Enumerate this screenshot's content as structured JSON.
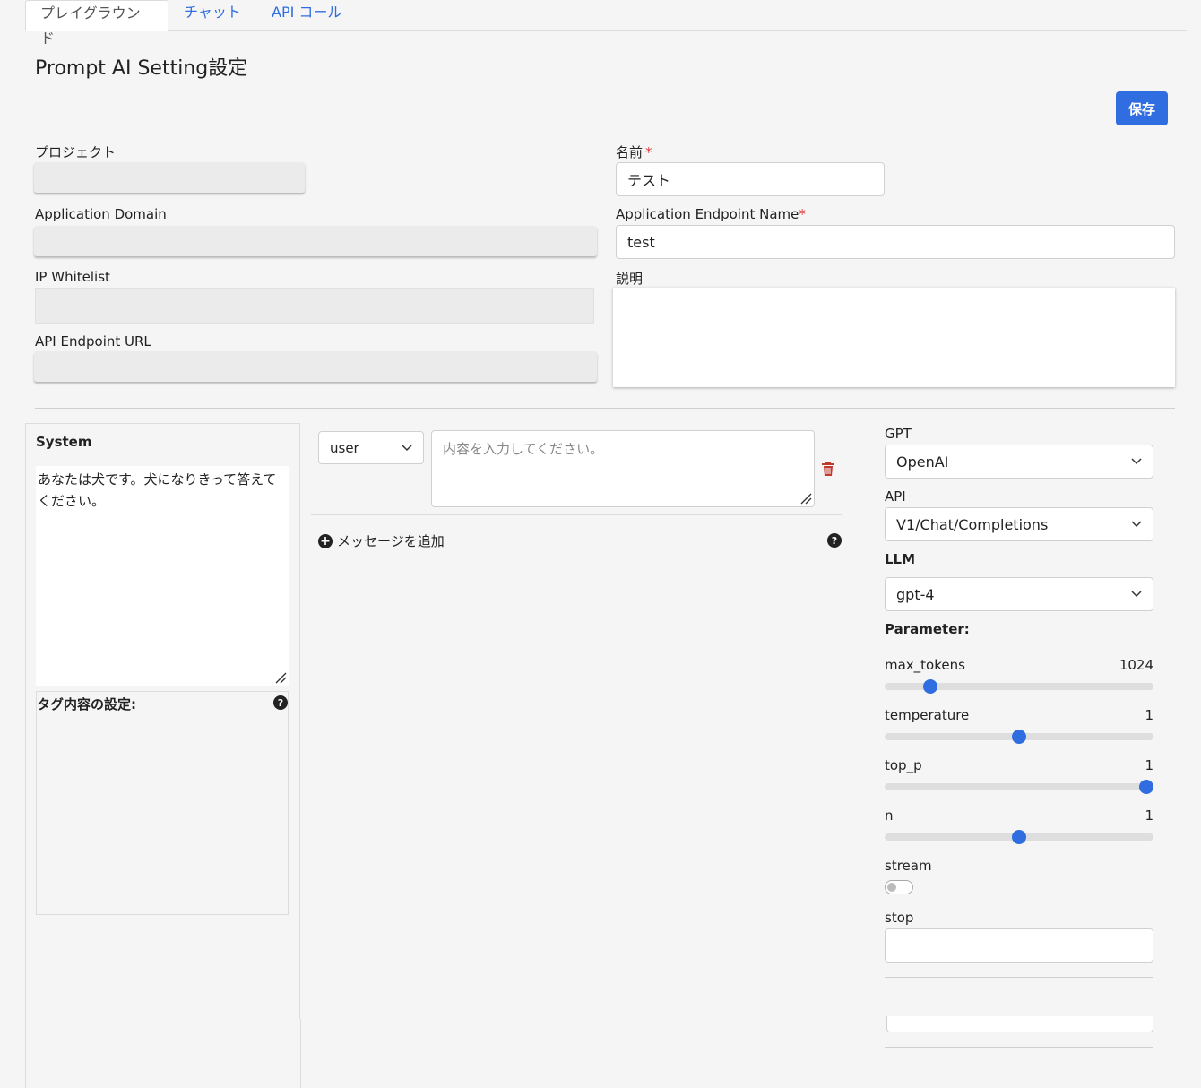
{
  "tabs": [
    {
      "label": "プレイグラウンド",
      "active": true
    },
    {
      "label": "チャット",
      "active": false
    },
    {
      "label": "API コール",
      "active": false
    }
  ],
  "page": {
    "title": "Prompt AI Setting設定",
    "save_label": "保存"
  },
  "form": {
    "project_label": "プロジェクト",
    "project_value": "",
    "app_domain_label": "Application Domain",
    "app_domain_value": "",
    "ip_whitelist_label": "IP Whitelist",
    "ip_whitelist_value": "",
    "api_endpoint_url_label": "API Endpoint URL",
    "api_endpoint_url_value": "",
    "name_label": "名前",
    "name_required": "*",
    "name_value": "テスト",
    "endpoint_name_label": "Application Endpoint Name",
    "endpoint_name_required": "*",
    "endpoint_name_value": "test",
    "description_label": "説明",
    "description_value": ""
  },
  "system": {
    "title": "System",
    "text": "あなたは犬です。犬になりきって答えてください。",
    "tag_title": "タグ内容の設定:"
  },
  "messages": {
    "role": "user",
    "placeholder": "内容を入力してください。",
    "add_label": "メッセージを追加"
  },
  "settings": {
    "gpt_label": "GPT",
    "gpt_value": "OpenAI",
    "api_label": "API",
    "api_value": "V1/Chat/Completions",
    "llm_label": "LLM",
    "llm_value": "gpt-4",
    "parameter_label": "Parameter:",
    "params": [
      {
        "name": "max_tokens",
        "value": "1024",
        "position": 0.15
      },
      {
        "name": "temperature",
        "value": "1",
        "position": 0.5
      },
      {
        "name": "top_p",
        "value": "1",
        "position": 1.0
      },
      {
        "name": "n",
        "value": "1",
        "position": 0.5
      }
    ],
    "stream_label": "stream",
    "stream_on": false,
    "stop_label": "stop",
    "stop_value": ""
  },
  "colors": {
    "accent": "#2f6de1",
    "danger": "#c0392b"
  }
}
